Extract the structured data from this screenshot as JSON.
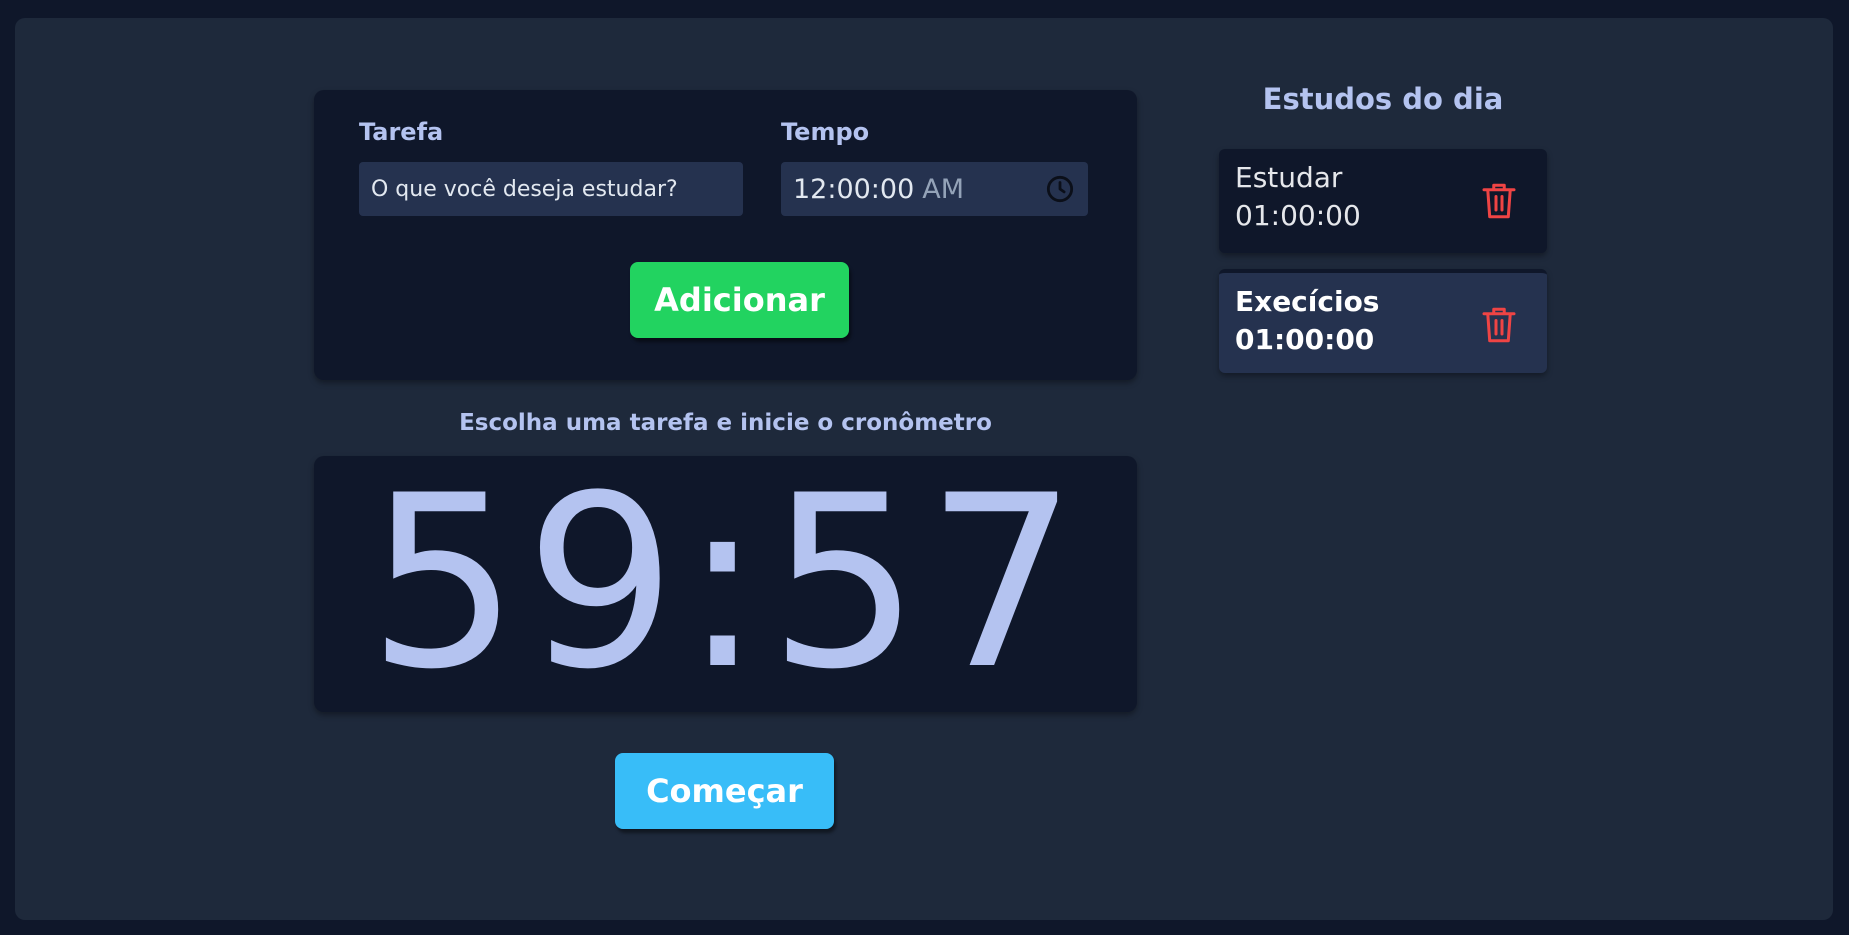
{
  "form": {
    "task_label": "Tarefa",
    "task_placeholder": "O que você deseja estudar?",
    "time_label": "Tempo",
    "time_value": "12:00:00",
    "time_ampm": "AM",
    "add_button": "Adicionar"
  },
  "timer": {
    "hint": "Escolha uma tarefa e inicie o cronômetro",
    "display": "59:57",
    "start_button": "Começar"
  },
  "list": {
    "title": "Estudos do dia",
    "items": [
      {
        "name": "Estudar",
        "time": "01:00:00",
        "selected": false
      },
      {
        "name": "Execícios",
        "time": "01:00:00",
        "selected": true
      }
    ]
  },
  "colors": {
    "background": "#0f172a",
    "panel": "#1e293b",
    "card": "#0f172a",
    "input": "#25324f",
    "text_accent": "#b4c3f0",
    "add_button": "#22d360",
    "start_button": "#38bdf8",
    "trash": "#ef4444"
  },
  "icons": {
    "time_field": "clock-icon",
    "delete": "trash-icon"
  }
}
